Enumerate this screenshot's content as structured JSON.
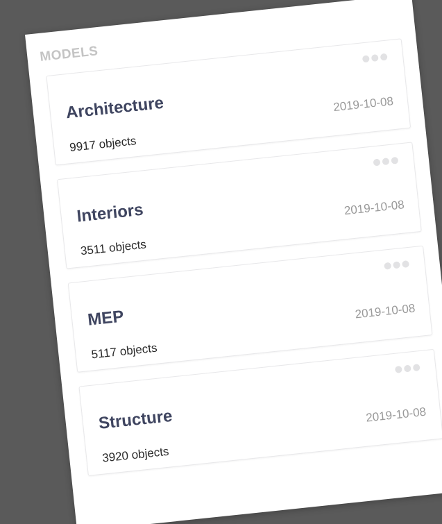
{
  "panel": {
    "title": "MODELS"
  },
  "models": [
    {
      "name": "Architecture",
      "count": "9917 objects",
      "date": "2019-10-08"
    },
    {
      "name": "Interiors",
      "count": "3511 objects",
      "date": "2019-10-08"
    },
    {
      "name": "MEP",
      "count": "5117 objects",
      "date": "2019-10-08"
    },
    {
      "name": "Structure",
      "count": "3920 objects",
      "date": "2019-10-08"
    }
  ],
  "icons": {
    "card_menu": "more-horizontal-icon"
  },
  "colors": {
    "background": "#5a5a5a",
    "panel": "#ffffff",
    "title_muted": "#c4c4c4",
    "card_title": "#3f4560",
    "date": "#9a9a9a"
  }
}
